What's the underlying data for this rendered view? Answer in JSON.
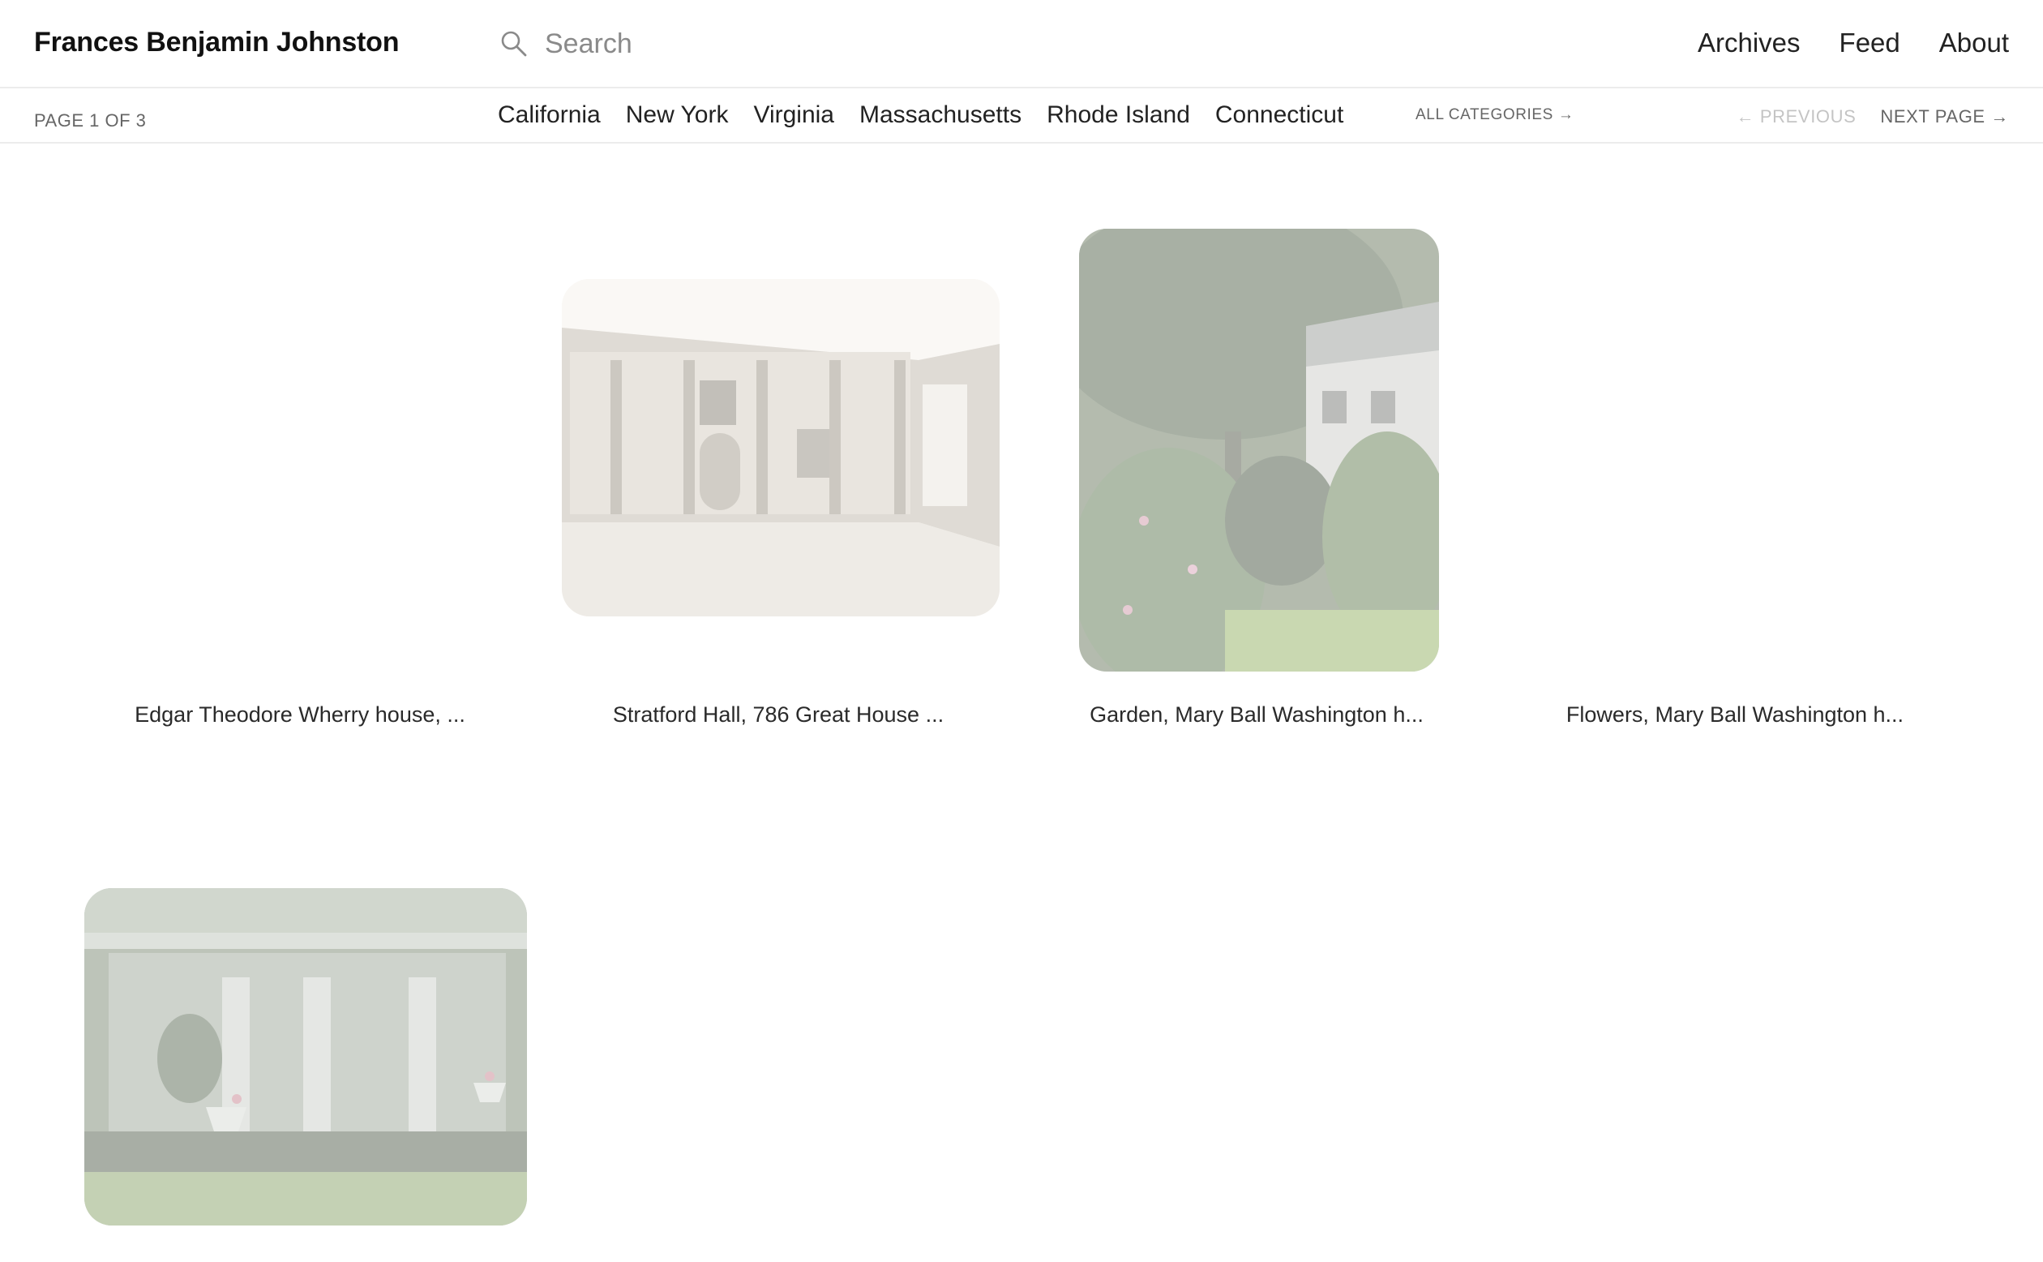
{
  "header": {
    "site_title": "Frances Benjamin Johnston",
    "search": {
      "placeholder": "Search",
      "value": ""
    },
    "nav": [
      "Archives",
      "Feed",
      "About"
    ]
  },
  "subbar": {
    "page_indicator": "PAGE 1 OF 3",
    "categories": [
      "California",
      "New York",
      "Virginia",
      "Massachusetts",
      "Rhode Island",
      "Connecticut"
    ],
    "all_categories": "ALL CATEGORIES →",
    "previous": "← PREVIOUS",
    "next": "NEXT PAGE →"
  },
  "gallery": [
    {
      "caption": "Edgar Theodore Wherry house, ...",
      "image": "none-loaded"
    },
    {
      "caption": "Stratford Hall, 786 Great House ...",
      "image": "interior-great-hall-photo"
    },
    {
      "caption": "Garden, Mary Ball Washington h...",
      "image": "garden-house-photo"
    },
    {
      "caption": "Flowers, Mary Ball Washington h...",
      "image": "none-loaded"
    },
    {
      "caption": "",
      "image": "colonnade-garden-photo"
    }
  ],
  "colors": {
    "divider": "#ececec",
    "text_primary": "#1a1a1a",
    "text_muted": "#666666",
    "text_disabled": "#c4c4c4"
  }
}
